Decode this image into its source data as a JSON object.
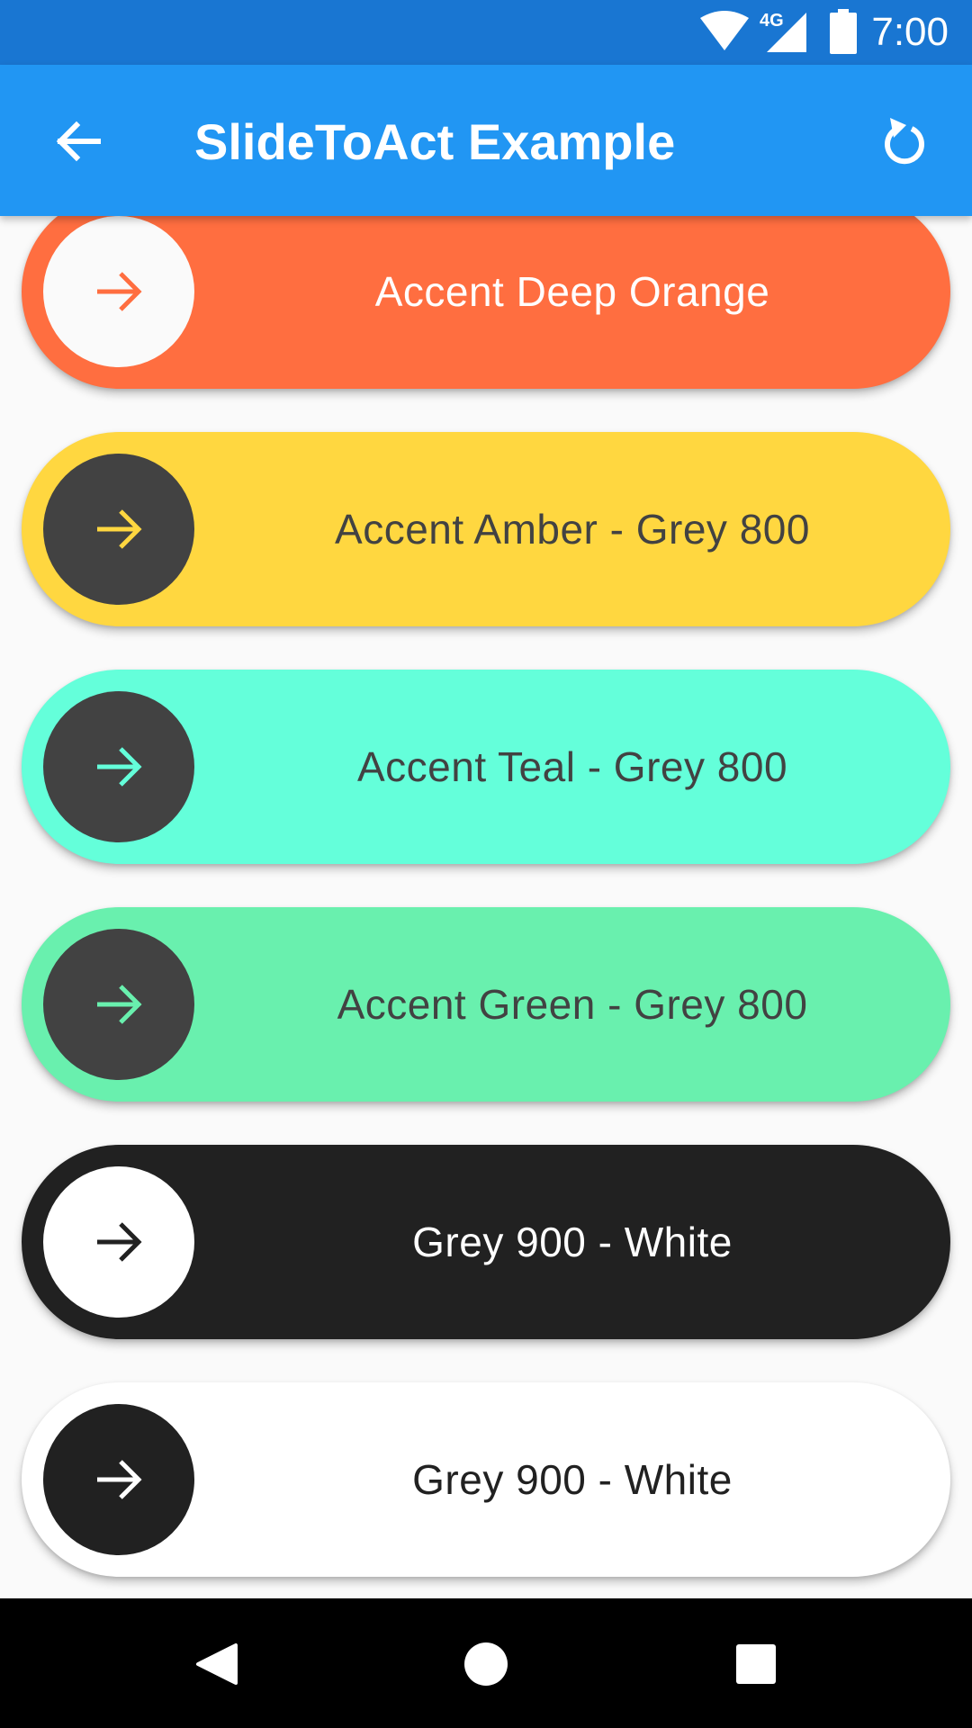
{
  "status_bar": {
    "time": "7:00",
    "network_label": "4G",
    "icons": [
      "wifi-icon",
      "cellular-signal-icon",
      "battery-icon"
    ]
  },
  "app_bar": {
    "title": "SlideToAct Example",
    "background_color": "#2196f3",
    "icons": [
      "back-arrow-icon",
      "refresh-icon"
    ]
  },
  "sliders": [
    {
      "label": "Accent Deep Orange",
      "background": "#ff6e40",
      "knob": "#fafafa",
      "arrow": "#ff6e40",
      "text_color": "#ffffff"
    },
    {
      "label": "Accent Amber - Grey 800",
      "background": "#ffd740",
      "knob": "#424242",
      "arrow": "#ffd740",
      "text_color": "#424242"
    },
    {
      "label": "Accent Teal - Grey 800",
      "background": "#64ffda",
      "knob": "#424242",
      "arrow": "#64ffda",
      "text_color": "#424242"
    },
    {
      "label": "Accent Green - Grey 800",
      "background": "#69f0ae",
      "knob": "#424242",
      "arrow": "#69f0ae",
      "text_color": "#424242"
    },
    {
      "label": "Grey 900 - White",
      "background": "#212121",
      "knob": "#ffffff",
      "arrow": "#212121",
      "text_color": "#ffffff"
    },
    {
      "label": "Grey 900 - White",
      "background": "#ffffff",
      "knob": "#212121",
      "arrow": "#ffffff",
      "text_color": "#212121"
    }
  ],
  "nav_bar": {
    "icons": [
      "back-triangle-icon",
      "home-circle-icon",
      "recents-square-icon"
    ]
  }
}
